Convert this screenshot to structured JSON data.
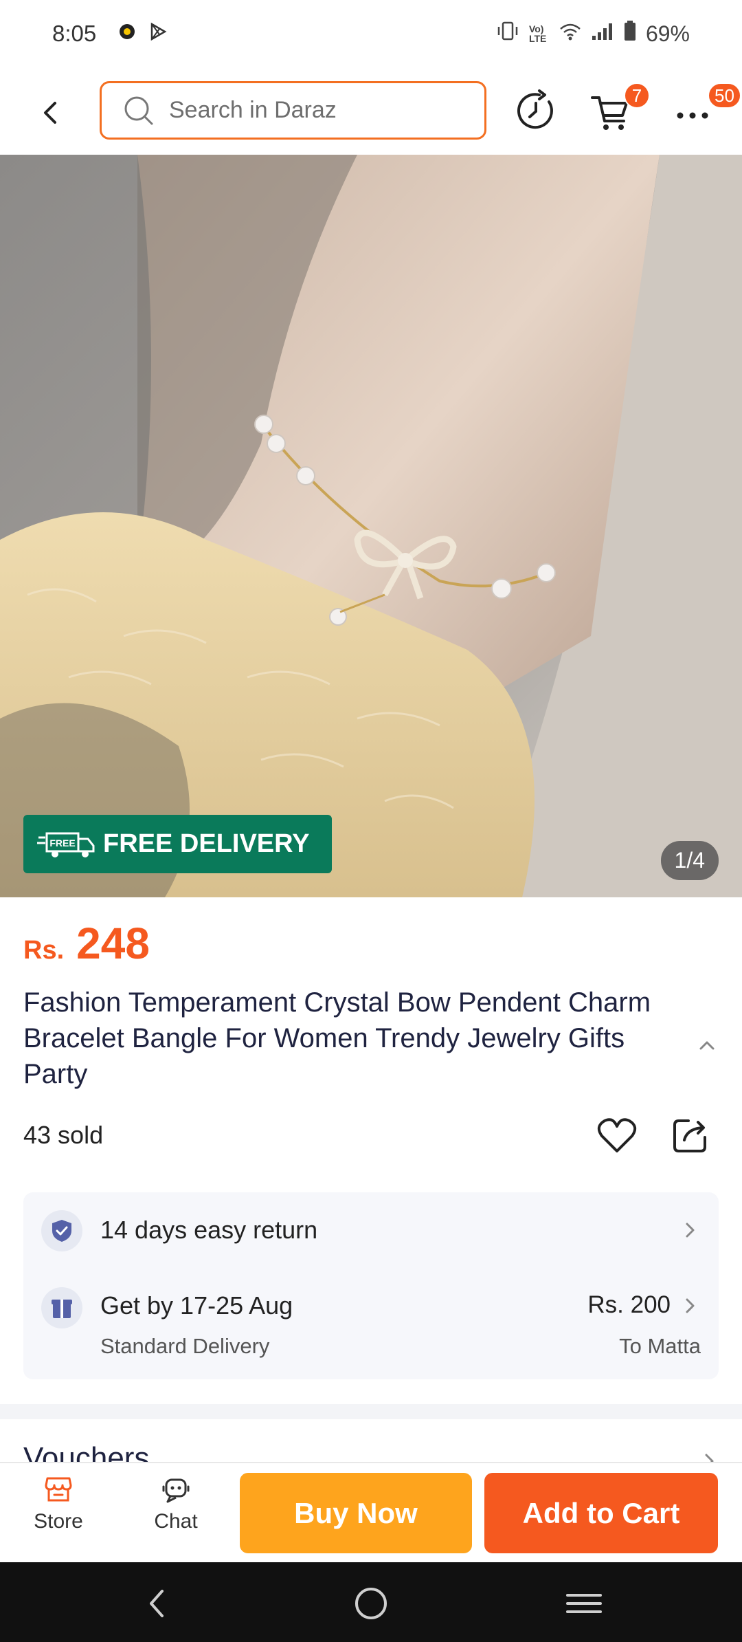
{
  "status_bar": {
    "time": "8:05",
    "battery": "69%",
    "icons": [
      "notification-icon",
      "play-store-icon",
      "vibrate-icon",
      "volte-icon",
      "wifi-icon",
      "signal-icon",
      "battery-icon"
    ],
    "volte_label": "Vo) LTE"
  },
  "header": {
    "search_placeholder": "Search in Daraz",
    "cart_badge": "7",
    "more_badge": "50"
  },
  "image": {
    "free_delivery_tag": "FREE",
    "free_delivery_label": "FREE DELIVERY",
    "pager": "1/4"
  },
  "product": {
    "currency": "Rs.",
    "price": "248",
    "title": "Fashion Temperament Crystal Bow Pendent Charm Bracelet Bangle For Women Trendy Jewelry Gifts Party",
    "sold": "43 sold"
  },
  "services": {
    "return_label": "14 days easy return",
    "delivery_label": "Get by 17-25 Aug",
    "delivery_type": "Standard Delivery",
    "delivery_price": "Rs. 200",
    "delivery_dest": "To Matta"
  },
  "vouchers_label": "Vouchers",
  "action_bar": {
    "store_label": "Store",
    "chat_label": "Chat",
    "buy_now": "Buy Now",
    "add_to_cart": "Add to Cart"
  },
  "colors": {
    "brand_orange": "#f5591f",
    "buy_yellow": "#fea41d",
    "delivery_green": "#0a7a5a"
  }
}
